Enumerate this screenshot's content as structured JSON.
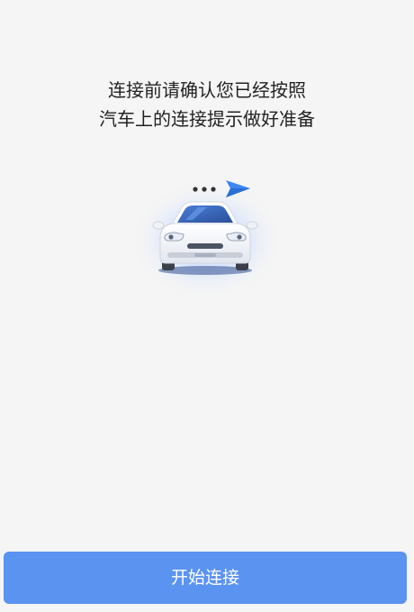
{
  "prompt": {
    "line1": "连接前请确认您已经按照",
    "line2": "汽车上的连接提示做好准备"
  },
  "illustration": {
    "icons": [
      "car-icon",
      "ellipsis-icon",
      "paper-plane-icon"
    ],
    "accent_color": "#3b82f6"
  },
  "actions": {
    "start_label": "开始连接",
    "button_color": "#5b93f0"
  }
}
